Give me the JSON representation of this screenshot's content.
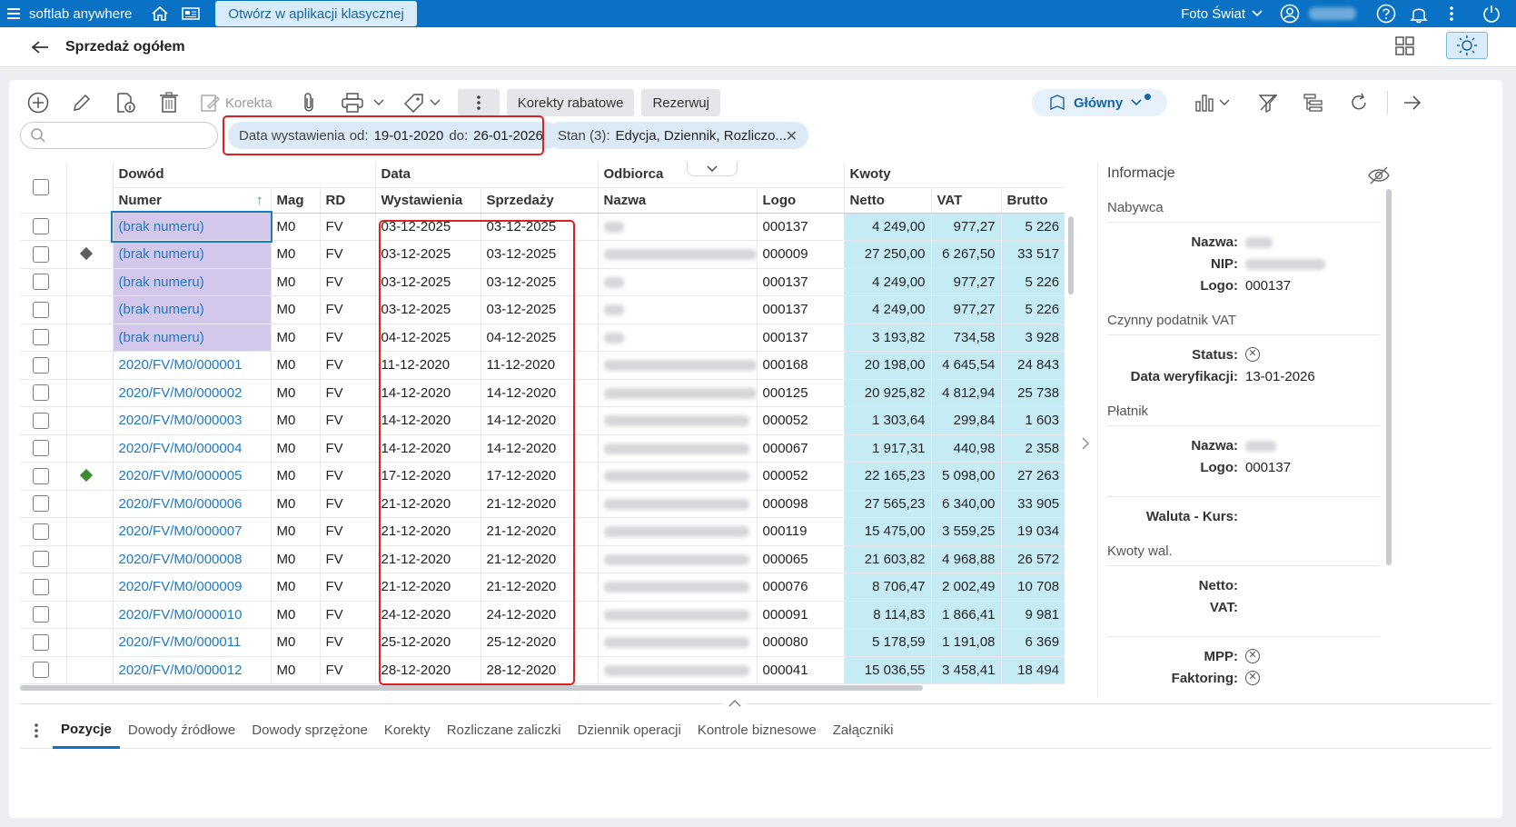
{
  "topbar": {
    "app_name": "softlab anywhere",
    "open_classic": "Otwórz w aplikacji klasycznej",
    "company": "Foto Świat"
  },
  "page": {
    "title": "Sprzedaż ogółem"
  },
  "toolbar": {
    "korekta": "Korekta",
    "korekty_rabatowe": "Korekty rabatowe",
    "rezerwuj": "Rezerwuj",
    "glowny": "Główny"
  },
  "filters": {
    "date_label": "Data wystawienia",
    "od_label": "od:",
    "od_value": "19-01-2020",
    "do_label": "do:",
    "do_value": "26-01-2026",
    "stan_label": "Stan (3):",
    "stan_value": "Edycja, Dziennik, Rozliczo..."
  },
  "grid": {
    "group_headers": {
      "dowod": "Dowód",
      "data": "Data",
      "odbiorca": "Odbiorca",
      "kwoty": "Kwoty"
    },
    "columns": {
      "numer": "Numer",
      "mag": "Mag",
      "rd": "RD",
      "wystawienia": "Wystawienia",
      "sprzedazy": "Sprzedaży",
      "nazwa": "Nazwa",
      "logo": "Logo",
      "netto": "Netto",
      "vat": "VAT",
      "brutto": "Brutto"
    },
    "rows": [
      {
        "numer": "(brak numeru)",
        "mag": "M0",
        "rd": "FV",
        "wyst": "03-12-2025",
        "sprz": "03-12-2025",
        "logo": "000137",
        "netto": "4 249,00",
        "vat": "977,27",
        "brutto": "5 226"
      },
      {
        "numer": "(brak numeru)",
        "mag": "M0",
        "rd": "FV",
        "wyst": "03-12-2025",
        "sprz": "03-12-2025",
        "logo": "000009",
        "netto": "27 250,00",
        "vat": "6 267,50",
        "brutto": "33 517"
      },
      {
        "numer": "(brak numeru)",
        "mag": "M0",
        "rd": "FV",
        "wyst": "03-12-2025",
        "sprz": "03-12-2025",
        "logo": "000137",
        "netto": "4 249,00",
        "vat": "977,27",
        "brutto": "5 226"
      },
      {
        "numer": "(brak numeru)",
        "mag": "M0",
        "rd": "FV",
        "wyst": "03-12-2025",
        "sprz": "03-12-2025",
        "logo": "000137",
        "netto": "4 249,00",
        "vat": "977,27",
        "brutto": "5 226"
      },
      {
        "numer": "(brak numeru)",
        "mag": "M0",
        "rd": "FV",
        "wyst": "04-12-2025",
        "sprz": "04-12-2025",
        "logo": "000137",
        "netto": "3 193,82",
        "vat": "734,58",
        "brutto": "3 928"
      },
      {
        "numer": "2020/FV/M0/000001",
        "mag": "M0",
        "rd": "FV",
        "wyst": "11-12-2020",
        "sprz": "11-12-2020",
        "logo": "000168",
        "netto": "20 198,00",
        "vat": "4 645,54",
        "brutto": "24 843"
      },
      {
        "numer": "2020/FV/M0/000002",
        "mag": "M0",
        "rd": "FV",
        "wyst": "14-12-2020",
        "sprz": "14-12-2020",
        "logo": "000125",
        "netto": "20 925,82",
        "vat": "4 812,94",
        "brutto": "25 738"
      },
      {
        "numer": "2020/FV/M0/000003",
        "mag": "M0",
        "rd": "FV",
        "wyst": "14-12-2020",
        "sprz": "14-12-2020",
        "logo": "000052",
        "netto": "1 303,64",
        "vat": "299,84",
        "brutto": "1 603"
      },
      {
        "numer": "2020/FV/M0/000004",
        "mag": "M0",
        "rd": "FV",
        "wyst": "14-12-2020",
        "sprz": "14-12-2020",
        "logo": "000067",
        "netto": "1 917,31",
        "vat": "440,98",
        "brutto": "2 358"
      },
      {
        "numer": "2020/FV/M0/000005",
        "mag": "M0",
        "rd": "FV",
        "wyst": "17-12-2020",
        "sprz": "17-12-2020",
        "logo": "000052",
        "netto": "22 165,23",
        "vat": "5 098,00",
        "brutto": "27 263"
      },
      {
        "numer": "2020/FV/M0/000006",
        "mag": "M0",
        "rd": "FV",
        "wyst": "21-12-2020",
        "sprz": "21-12-2020",
        "logo": "000098",
        "netto": "27 565,23",
        "vat": "6 340,00",
        "brutto": "33 905"
      },
      {
        "numer": "2020/FV/M0/000007",
        "mag": "M0",
        "rd": "FV",
        "wyst": "21-12-2020",
        "sprz": "21-12-2020",
        "logo": "000119",
        "netto": "15 475,00",
        "vat": "3 559,25",
        "brutto": "19 034"
      },
      {
        "numer": "2020/FV/M0/000008",
        "mag": "M0",
        "rd": "FV",
        "wyst": "21-12-2020",
        "sprz": "21-12-2020",
        "logo": "000065",
        "netto": "21 603,82",
        "vat": "4 968,88",
        "brutto": "26 572"
      },
      {
        "numer": "2020/FV/M0/000009",
        "mag": "M0",
        "rd": "FV",
        "wyst": "21-12-2020",
        "sprz": "21-12-2020",
        "logo": "000076",
        "netto": "8 706,47",
        "vat": "2 002,49",
        "brutto": "10 708"
      },
      {
        "numer": "2020/FV/M0/000010",
        "mag": "M0",
        "rd": "FV",
        "wyst": "24-12-2020",
        "sprz": "24-12-2020",
        "logo": "000091",
        "netto": "8 114,83",
        "vat": "1 866,41",
        "brutto": "9 981"
      },
      {
        "numer": "2020/FV/M0/000011",
        "mag": "M0",
        "rd": "FV",
        "wyst": "25-12-2020",
        "sprz": "25-12-2020",
        "logo": "000080",
        "netto": "5 178,59",
        "vat": "1 191,08",
        "brutto": "6 369"
      },
      {
        "numer": "2020/FV/M0/000012",
        "mag": "M0",
        "rd": "FV",
        "wyst": "28-12-2020",
        "sprz": "28-12-2020",
        "logo": "000041",
        "netto": "15 036,55",
        "vat": "3 458,41",
        "brutto": "18 494"
      }
    ]
  },
  "info": {
    "title": "Informacje",
    "nabywca": "Nabywca",
    "nazwa_label": "Nazwa:",
    "nip_label": "NIP:",
    "logo_label": "Logo:",
    "nabywca_logo": "000137",
    "czynny": "Czynny podatnik VAT",
    "status_label": "Status:",
    "data_wer_label": "Data weryfikacji:",
    "data_wer_value": "13-01-2026",
    "platnik": "Płatnik",
    "platnik_logo": "000137",
    "waluta_label": "Waluta - Kurs:",
    "kwoty_wal": "Kwoty wal.",
    "netto_label": "Netto:",
    "vat_label": "VAT:",
    "mpp_label": "MPP:",
    "faktoring_label": "Faktoring:"
  },
  "tabs": [
    "Pozycje",
    "Dowody źródłowe",
    "Dowody sprzężone",
    "Korekty",
    "Rozliczane zaliczki",
    "Dziennik operacji",
    "Kontrole biznesowe",
    "Załączniki"
  ],
  "colors": {
    "brand": "#0a72c4",
    "purple_cell": "#d3c8ec",
    "amount_cell": "#c5ecf5",
    "highlight": "#e02020"
  }
}
